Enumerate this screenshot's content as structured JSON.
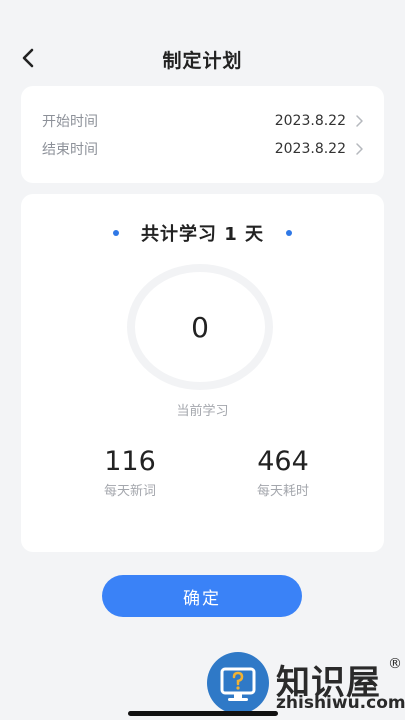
{
  "header": {
    "title": "制定计划"
  },
  "dates": {
    "start_label": "开始时间",
    "start_value": "2023.8.22",
    "end_label": "结束时间",
    "end_value": "2023.8.22"
  },
  "plan": {
    "title": "共计学习 1 天",
    "current_value": "0",
    "current_caption": "当前学习",
    "daily_words_value": "116",
    "daily_words_caption": "每天新词",
    "daily_time_value": "464",
    "daily_time_caption": "每天耗时"
  },
  "actions": {
    "confirm_label": "确定"
  },
  "watermark": {
    "brand": "知识屋",
    "reg": "®",
    "domain": "zhishiwu.com"
  },
  "colors": {
    "accent": "#3a82f7",
    "background": "#f3f4f6",
    "muted": "#a4a7ad"
  }
}
